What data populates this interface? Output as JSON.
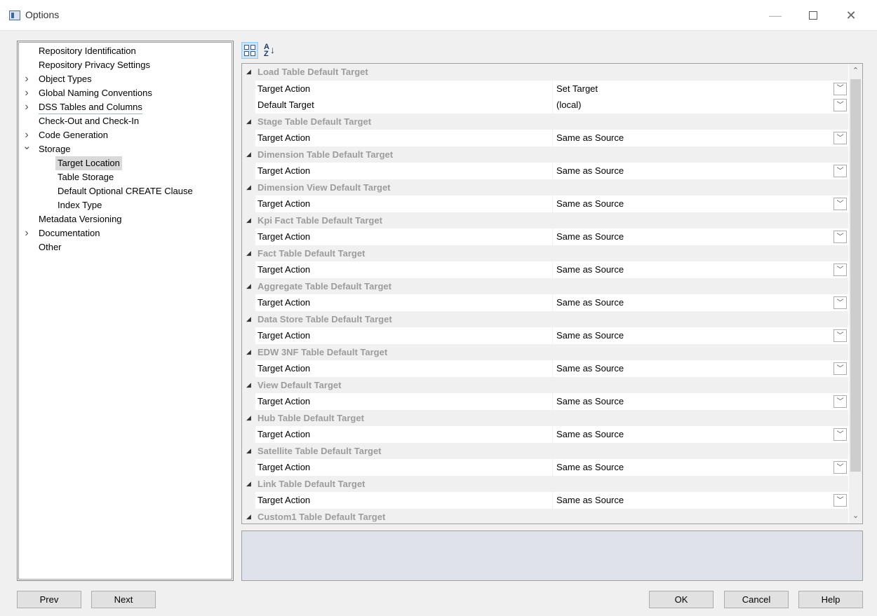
{
  "window": {
    "title": "Options"
  },
  "tree": [
    {
      "label": "Repository Identification",
      "level": 0,
      "chevron": ""
    },
    {
      "label": "Repository Privacy Settings",
      "level": 0,
      "chevron": ""
    },
    {
      "label": "Object Types",
      "level": 0,
      "chevron": ">"
    },
    {
      "label": "Global Naming Conventions",
      "level": 0,
      "chevron": ">"
    },
    {
      "label": "DSS Tables and Columns",
      "level": 0,
      "chevron": ">",
      "underline": true
    },
    {
      "label": "Check-Out and Check-In",
      "level": 0,
      "chevron": ""
    },
    {
      "label": "Code Generation",
      "level": 0,
      "chevron": ">"
    },
    {
      "label": "Storage",
      "level": 0,
      "chevron": "v"
    },
    {
      "label": "Target Location",
      "level": 1,
      "chevron": "",
      "selected": true
    },
    {
      "label": "Table Storage",
      "level": 1,
      "chevron": ""
    },
    {
      "label": "Default Optional CREATE Clause",
      "level": 1,
      "chevron": ""
    },
    {
      "label": "Index Type",
      "level": 1,
      "chevron": ""
    },
    {
      "label": "Metadata Versioning",
      "level": 0,
      "chevron": ""
    },
    {
      "label": "Documentation",
      "level": 0,
      "chevron": ">"
    },
    {
      "label": "Other",
      "level": 0,
      "chevron": ""
    }
  ],
  "toolbar": {
    "categorized_icon": "categorized-icon",
    "alphabetical_icon": "sort-alpha-icon"
  },
  "grid": {
    "categories": [
      {
        "label": "Load Table Default Target",
        "props": [
          {
            "name": "Target Action",
            "value": "Set Target"
          },
          {
            "name": "Default Target",
            "value": "(local)"
          }
        ]
      },
      {
        "label": "Stage Table Default Target",
        "props": [
          {
            "name": "Target Action",
            "value": "Same as Source"
          }
        ]
      },
      {
        "label": "Dimension Table Default Target",
        "props": [
          {
            "name": "Target Action",
            "value": "Same as Source"
          }
        ]
      },
      {
        "label": "Dimension View Default Target",
        "props": [
          {
            "name": "Target Action",
            "value": "Same as Source"
          }
        ]
      },
      {
        "label": "Kpi Fact Table Default Target",
        "props": [
          {
            "name": "Target Action",
            "value": "Same as Source"
          }
        ]
      },
      {
        "label": "Fact Table Default Target",
        "props": [
          {
            "name": "Target Action",
            "value": "Same as Source"
          }
        ]
      },
      {
        "label": "Aggregate Table Default Target",
        "props": [
          {
            "name": "Target Action",
            "value": "Same as Source"
          }
        ]
      },
      {
        "label": "Data Store Table Default Target",
        "props": [
          {
            "name": "Target Action",
            "value": "Same as Source"
          }
        ]
      },
      {
        "label": "EDW 3NF Table Default Target",
        "props": [
          {
            "name": "Target Action",
            "value": "Same as Source"
          }
        ]
      },
      {
        "label": "View Default Target",
        "props": [
          {
            "name": "Target Action",
            "value": "Same as Source"
          }
        ]
      },
      {
        "label": "Hub Table Default Target",
        "props": [
          {
            "name": "Target Action",
            "value": "Same as Source"
          }
        ]
      },
      {
        "label": "Satellite Table Default Target",
        "props": [
          {
            "name": "Target Action",
            "value": "Same as Source"
          }
        ]
      },
      {
        "label": "Link Table Default Target",
        "props": [
          {
            "name": "Target Action",
            "value": "Same as Source"
          }
        ]
      },
      {
        "label": "Custom1 Table Default Target",
        "props": []
      }
    ]
  },
  "buttons": {
    "prev": "Prev",
    "next": "Next",
    "ok": "OK",
    "cancel": "Cancel",
    "help": "Help"
  }
}
